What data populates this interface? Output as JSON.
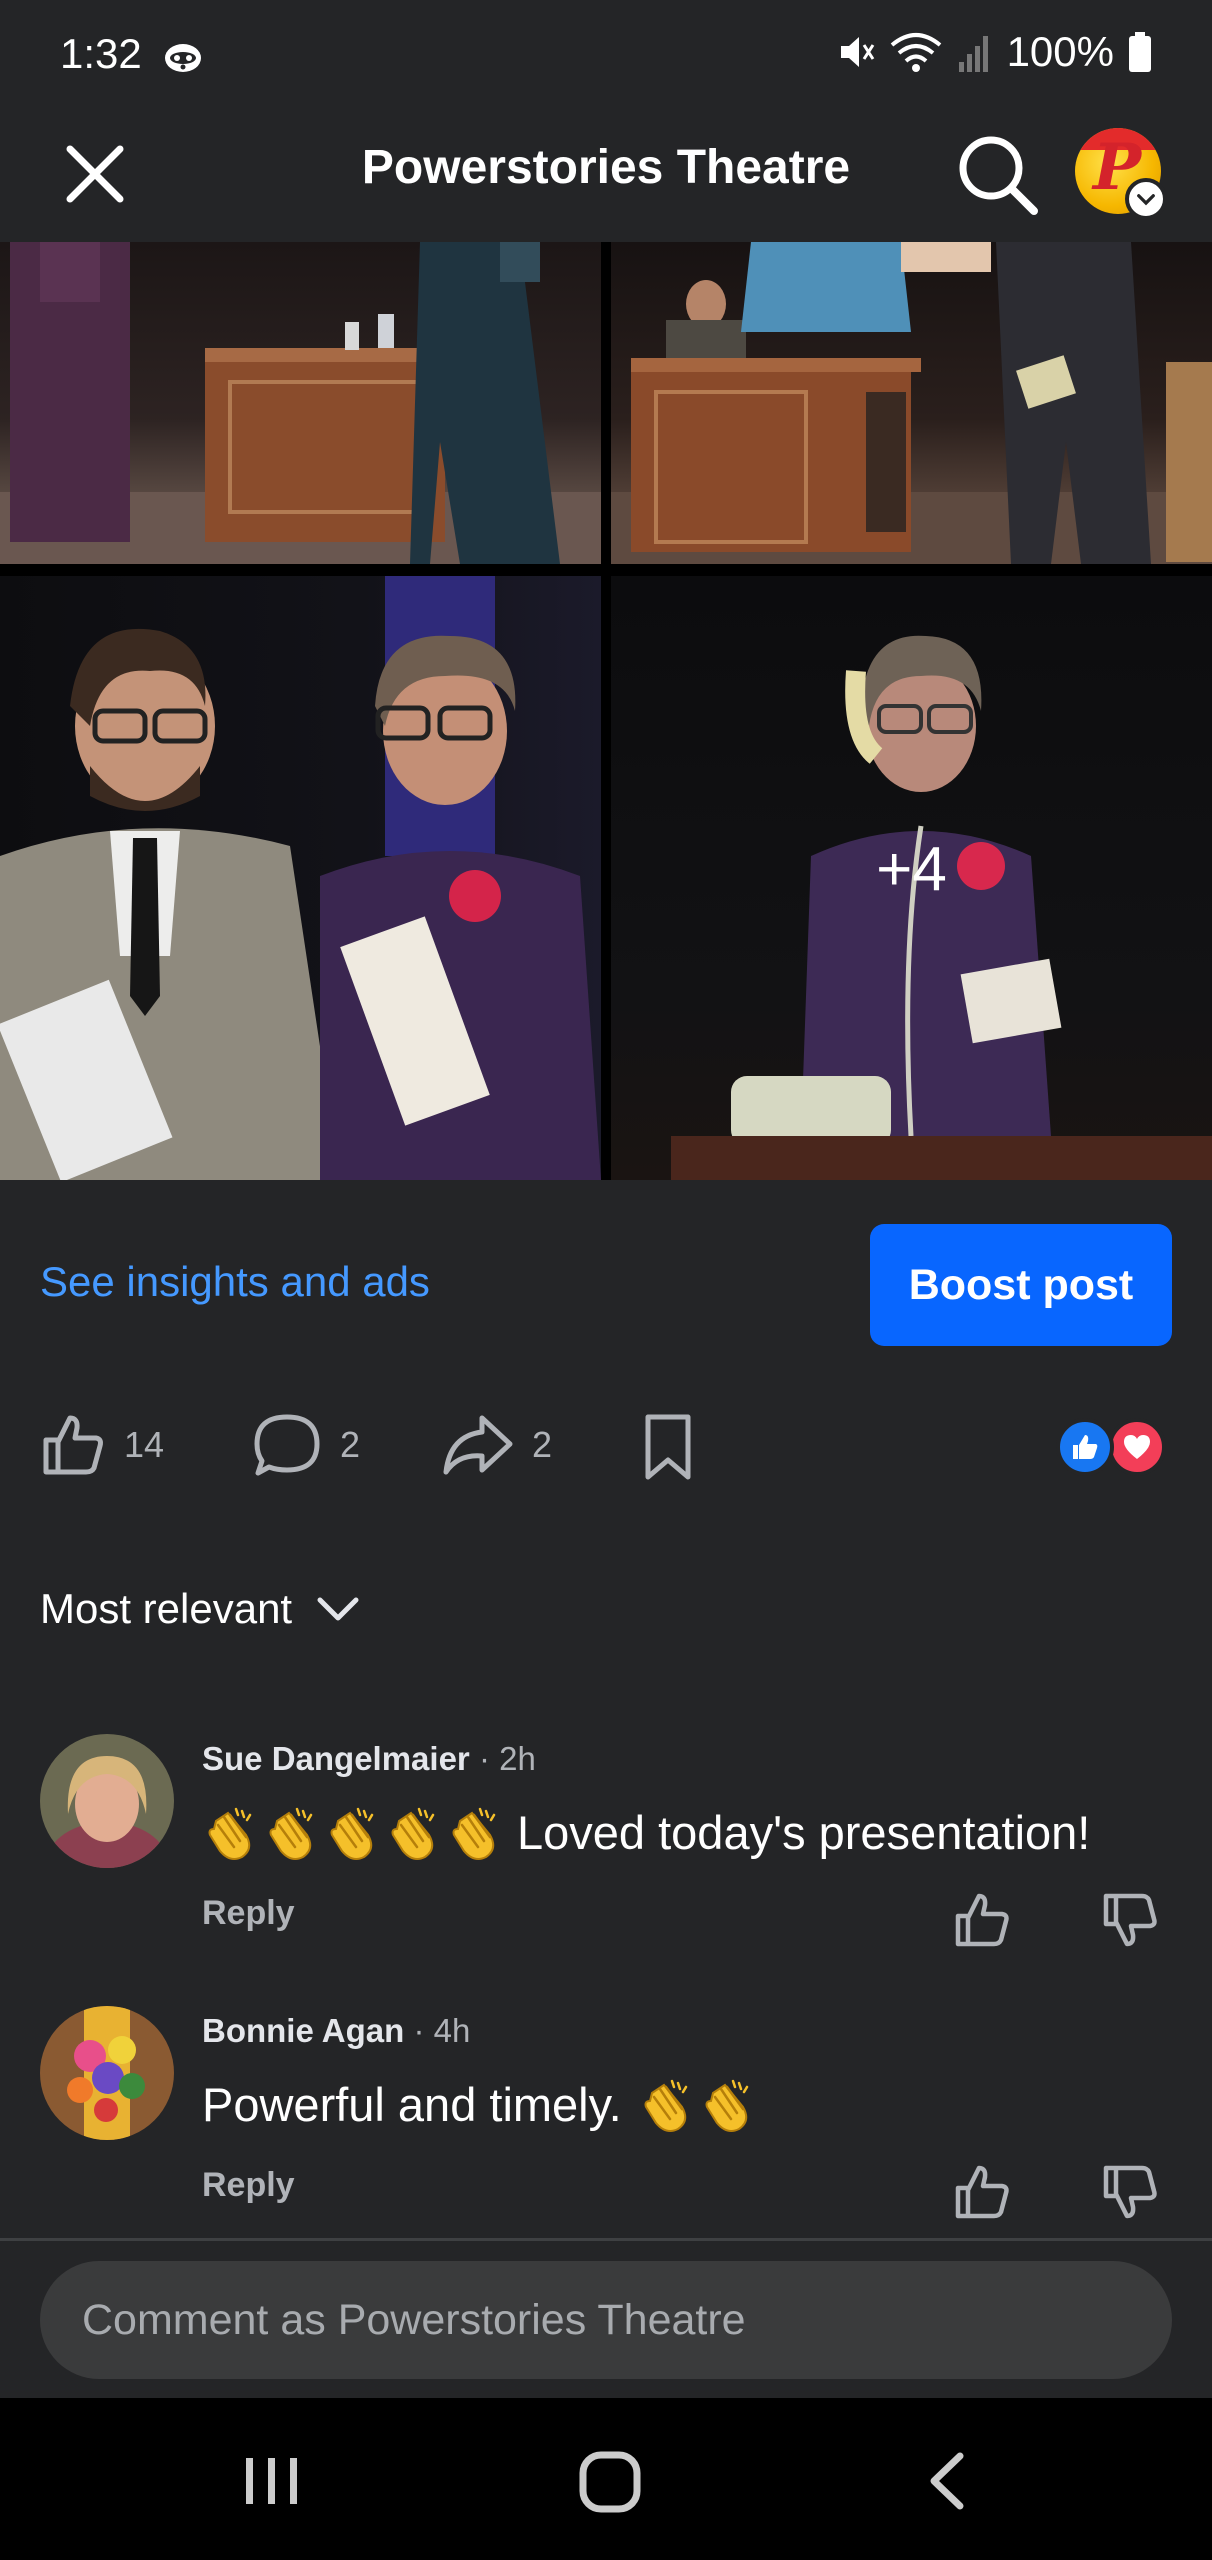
{
  "status": {
    "time": "1:32",
    "battery": "100%",
    "icons": [
      "raccoon-app-icon",
      "mute-icon",
      "wifi-icon",
      "signal-icon",
      "battery-icon"
    ]
  },
  "header": {
    "title": "Powerstories Theatre",
    "icons": [
      "close-icon",
      "search-icon",
      "profile-avatar"
    ]
  },
  "photos": {
    "more_count": "+4"
  },
  "post": {
    "insights_link": "See insights and ads",
    "boost_label": "Boost post",
    "likes": "14",
    "comments": "2",
    "shares": "2"
  },
  "comments_section": {
    "sort_label": "Most relevant",
    "items": [
      {
        "author": "Sue Dangelmaier",
        "time": "· 2h",
        "text": "Loved today's presentation!",
        "claps": 5,
        "reply": "Reply"
      },
      {
        "author": "Bonnie Agan",
        "time": "· 4h",
        "text": "Powerful and timely.",
        "claps": 2,
        "reply": "Reply"
      }
    ]
  },
  "composer": {
    "placeholder": "Comment as Powerstories Theatre"
  },
  "colors": {
    "background": "#242527",
    "link": "#4599ff",
    "boost": "#0866ff",
    "like": "#1877f2",
    "love": "#f33e58"
  }
}
